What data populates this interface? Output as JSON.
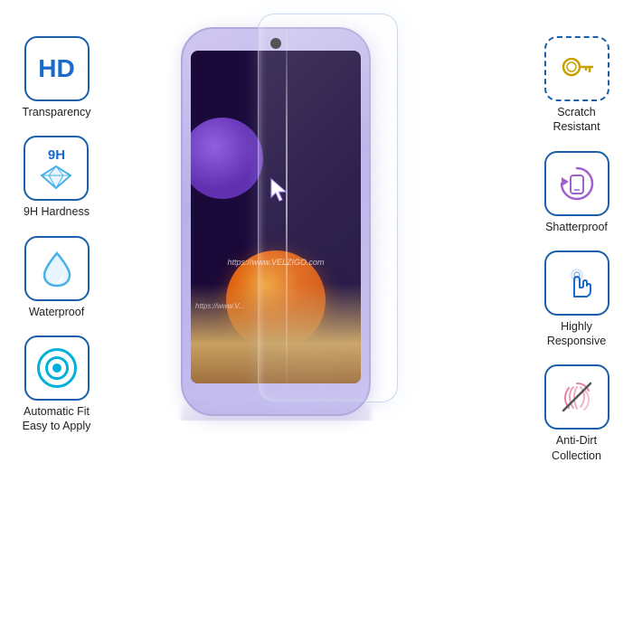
{
  "left_features": [
    {
      "id": "hd-transparency",
      "icon_type": "hd",
      "label": "Transparency"
    },
    {
      "id": "9h-hardness",
      "icon_type": "9h",
      "label": "9H Hardness"
    },
    {
      "id": "waterproof",
      "icon_type": "water",
      "label": "Waterproof"
    },
    {
      "id": "auto-fit",
      "icon_type": "target",
      "label": "Automatic Fit\nEasy to Apply"
    }
  ],
  "right_features": [
    {
      "id": "scratch-resistant",
      "icon_type": "key",
      "label": "Scratch\nResistant"
    },
    {
      "id": "shatterproof",
      "icon_type": "rotate",
      "label": "Shatterproof"
    },
    {
      "id": "highly-responsive",
      "icon_type": "touch",
      "label": "Highly\nResponsive"
    },
    {
      "id": "anti-dirt",
      "icon_type": "fingerprint",
      "label": "Anti-Dirt\nCollection"
    }
  ],
  "watermark": "https://www.VELZIGO.com",
  "watermark2": "https://www.V...",
  "accent_color": "#1a6acc",
  "border_color": "#1a5fa8"
}
